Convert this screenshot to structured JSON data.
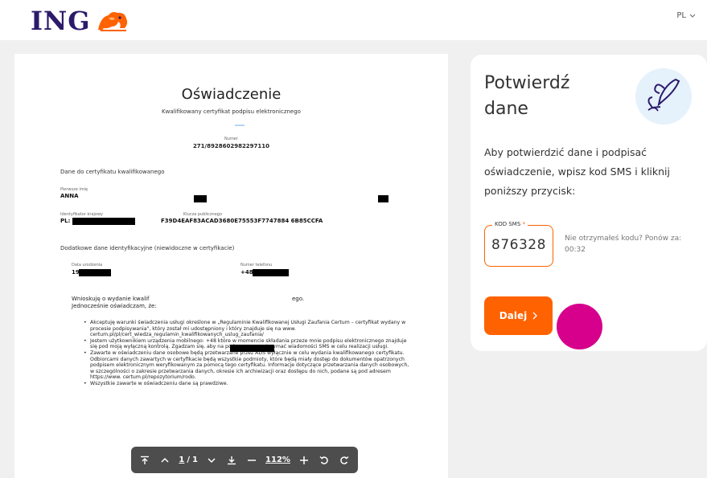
{
  "header": {
    "logo_text": "ING",
    "language": "PL"
  },
  "document": {
    "title": "Oświadczenie",
    "subtitle": "Kwalifikowany certyfikat podpisu elektronicznego",
    "number_label": "Numer",
    "number_value": "271/8928602982297110",
    "section_cert": "Dane do certyfikatu kwalifikowanego",
    "first_name_label": "Pierwsze imię",
    "first_name_value": "ANNA",
    "national_id_label": "Identyfikator krajowy",
    "national_id_value": "PL:",
    "public_key_label": "Klucza publicznego",
    "public_key_value": "F39D4EAF83ACAD3680E75553F7747884 6B85CCFA",
    "section_extra": "Dodatkowe dane identyfikacyjne (niewidoczne w certyfikacie)",
    "birth_label": "Data urodzenia",
    "birth_value": "19",
    "phone_label": "Numer telefonu",
    "phone_value": "+48",
    "request_line1_a": "Wnioskuję o wydanie kwalif",
    "request_line1_b": "ego.",
    "request_line2": "Jednocześnie oświadczam, że:",
    "bullets": [
      "Akceptuję warunki świadczenia usługi określone w „Regulaminie Kwalifikowanej Usługi Zaufania Certum – certyfikat wydany w procesie podpisywania\", który został mi udostępniony i który znajduje się na www. certum.pl/pl/cert_wiedza_regulamin_kwalifikowanych_uslug_zaufania/",
      "Jestem użytkownikiem urządzenia mobilnego: +48            które w momencie składania przeze mnie podpisu elektronicznego znajduje się pod moją wyłączną kontrolą. Zgadzam się, aby na podany numer otrzymać wiadomości SMS w celu realizacji usługi.",
      "Zawarte w oświadczeniu dane osobowe będą przetwarzane przez ADS wyłącznie w celu wydania kwalifikowanego certyfikatu. Odbiorcami danych zawartych w certyfikacie będą wszystkie podmioty, które będą miały dostęp do dokumentów opatrzonych podpisem elektronicznym weryfikowanym za pomocą tego certyfikatu. Informacje dotyczące przetwarzania danych osobowych, w szczególności o zakresie przetwarzania danych, okresie ich archiwizacji oraz dostępu do nich, podane są pod adresem https://www. certum.pl/repozytorium/rodo.",
      "Wszystkie zawarte w oświadczeniu dane są prawdziwe."
    ]
  },
  "pdf_toolbar": {
    "current_page": "1",
    "page_separator": "/",
    "total_pages": "1",
    "zoom": "112%"
  },
  "confirm": {
    "title": "Potwierdź dane",
    "description": "Aby potwierdzić dane i podpisać oświadczenie, wpisz kod SMS i kliknij poniższy przycisk:",
    "sms_label": "KOD SMS",
    "sms_required_mark": "*",
    "sms_value": "876328",
    "resend_text": "Nie otrzymałeś kodu? Ponów za: 00:32",
    "next_label": "Dalej"
  },
  "colors": {
    "accent": "#ff6200",
    "brand_navy": "#2c1a6b",
    "cursor_marker": "#d6008c"
  }
}
